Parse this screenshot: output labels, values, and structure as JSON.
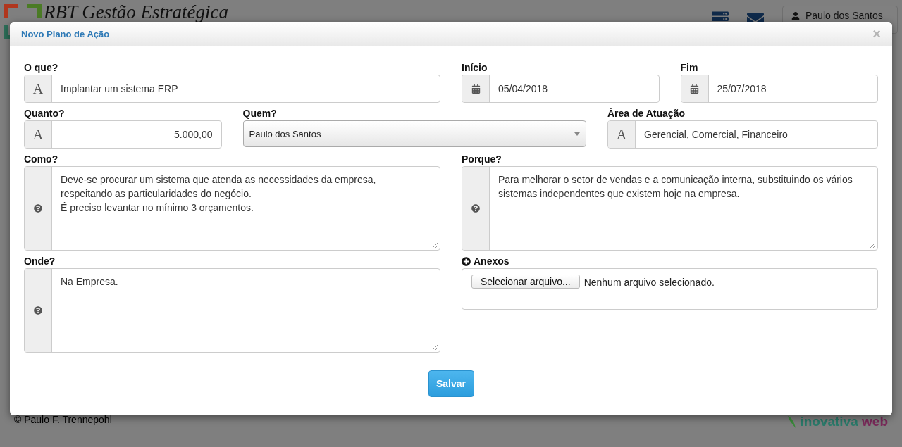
{
  "background": {
    "brand": "RBT Gestão Estratégica",
    "user_menu": "Paulo dos Santos",
    "footer": "© Paulo F. Trennepohl",
    "footer_logo": [
      "inovativa",
      "web"
    ]
  },
  "modal": {
    "title": "Novo Plano de Ação",
    "close": "×",
    "rows": [
      [
        {
          "label": "O que?",
          "kind": "text",
          "addon": "A",
          "value": "Implantar um sistema ERP"
        },
        {
          "label": "Início",
          "kind": "date",
          "value": "05/04/2018"
        },
        {
          "label": "Fim",
          "kind": "date",
          "value": "25/07/2018"
        }
      ],
      [
        {
          "label": "Quanto?",
          "kind": "number",
          "addon": "A",
          "value": "5.000,00"
        },
        {
          "label": "Quem?",
          "kind": "select",
          "value": "Paulo dos Santos"
        },
        {
          "label": "Área de Atuação",
          "kind": "text",
          "addon": "A",
          "value": "Gerencial, Comercial, Financeiro"
        }
      ],
      [
        {
          "label": "Como?",
          "kind": "textarea",
          "value": "Deve-se procurar um sistema que atenda as necessidades da empresa,\nrespeitando as particularidades do negócio.\nÉ preciso levantar no mínimo 3 orçamentos."
        },
        {
          "label": "Porque?",
          "kind": "textarea",
          "value": "Para melhorar o setor de vendas e a comunicação interna, substituindo os vários sistemas independentes que existem hoje na empresa."
        }
      ],
      [
        {
          "label": "Onde?",
          "kind": "textarea",
          "value": "Na Empresa."
        },
        {
          "label": "Anexos",
          "kind": "file",
          "button": "Selecionar arquivo...",
          "status": "Nenhum arquivo selecionado."
        }
      ]
    ],
    "submit": "Salvar"
  }
}
